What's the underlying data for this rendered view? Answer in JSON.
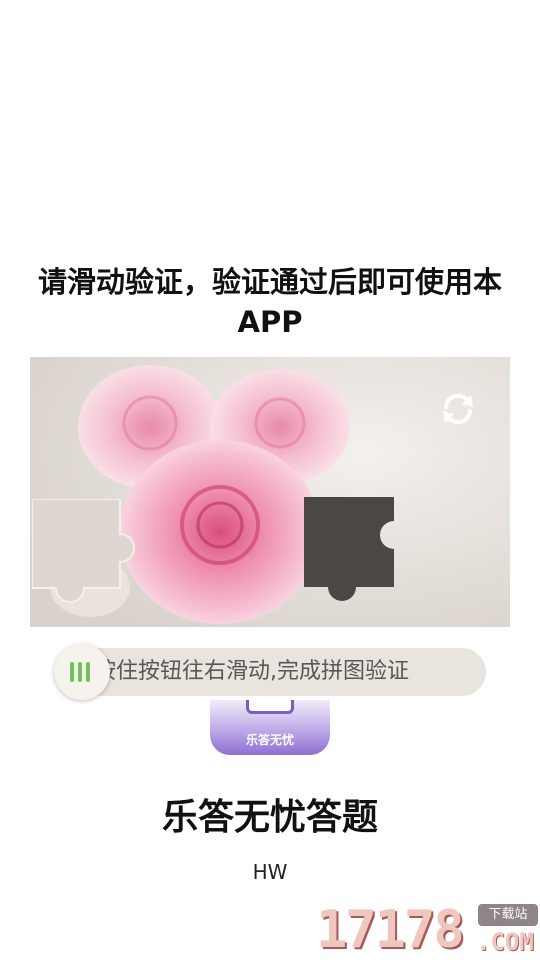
{
  "dialog": {
    "title": "请滑动验证，验证通过后即可使用本APP",
    "slider_hint": "按住按钮往右滑动,完成拼图验证",
    "refresh_icon": "refresh-icon",
    "slider_handle_icon": "three-bars-icon"
  },
  "app": {
    "logo_text": "乐答无忧",
    "name": "乐答无忧答题",
    "developer": "HW"
  },
  "watermark": {
    "digits": "17178",
    "badge": "下载站",
    "suffix": ".COM"
  },
  "colors": {
    "slider_track": "#eae4df",
    "handle_bars": "#6fc25a",
    "hole": "#4a4745",
    "accent_purple": "#8f6fd3"
  }
}
